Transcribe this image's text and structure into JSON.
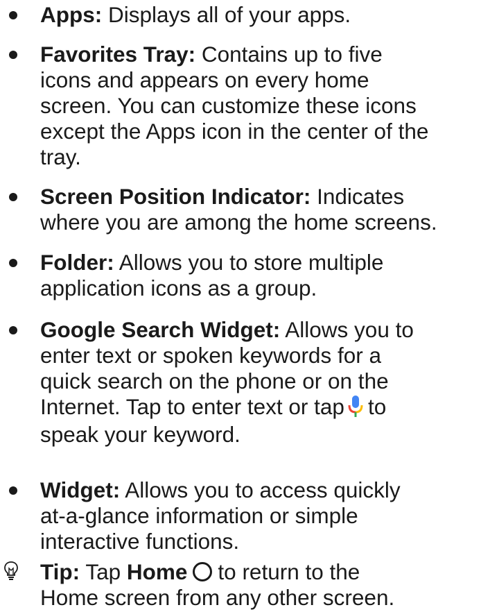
{
  "items": [
    {
      "term": "Apps:",
      "lines": [
        " Displays all of your apps."
      ]
    },
    {
      "term": "Favorites Tray:",
      "lines": [
        " Contains up to five",
        "icons and appears on every home",
        "screen. You can customize these icons",
        "except the Apps icon in the center of the",
        "tray."
      ]
    },
    {
      "term": "Screen Position Indicator:",
      "lines": [
        " Indicates",
        "where you are among the home screens."
      ]
    },
    {
      "term": "Folder:",
      "lines": [
        " Allows you to store multiple",
        "application icons as a group."
      ]
    },
    {
      "term": "Google Search Widget:",
      "lines": [
        " Allows you to",
        "enter text or spoken keywords for a",
        "quick search on the phone or on the",
        "Internet. Tap to enter text or tap",
        "speak your keyword."
      ],
      "line4_suffix": "to"
    },
    {
      "term": "Widget:",
      "lines": [
        " Allows you to access quickly",
        "at-a-glance information or simple",
        "interactive functions."
      ]
    }
  ],
  "tip": {
    "label": "Tip:",
    "tap": " Tap ",
    "home": "Home",
    "after_home": "to return to the",
    "line2": "Home screen from any other screen."
  },
  "icons": {
    "bullet": "bullet-dot",
    "mic": "microphone-icon",
    "home": "home-circle-icon",
    "tip": "lightbulb-icon"
  },
  "colors": {
    "text": "#1a1a1a",
    "mic_blue": "#4285F4",
    "mic_red": "#EA4335",
    "mic_yellow": "#FBBC05",
    "mic_green": "#34A853"
  }
}
